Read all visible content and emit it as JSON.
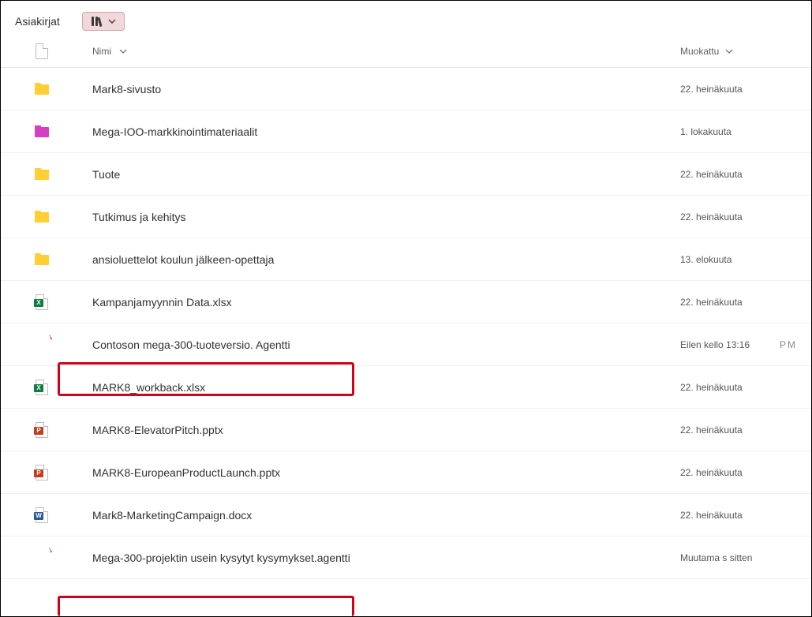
{
  "library_title": "Asiakirjat",
  "columns": {
    "name_label": "Nimi",
    "modified_label": "Muokattu"
  },
  "pm_suffix": "PM",
  "items": [
    {
      "icon": "folder",
      "name": "Mark8-sivusto",
      "modified": "22. heinäkuuta"
    },
    {
      "icon": "folder-pink",
      "name": "Mega-IOO-markkinointimateriaalit",
      "modified": "1. lokakuuta"
    },
    {
      "icon": "folder",
      "name": "Tuote",
      "modified": "22. heinäkuuta"
    },
    {
      "icon": "folder",
      "name": "Tutkimus ja kehitys",
      "modified": "22. heinäkuuta"
    },
    {
      "icon": "folder",
      "name": "ansioluettelot koulun jälkeen-opettaja",
      "modified": "13. elokuuta"
    },
    {
      "icon": "excel",
      "name": "Kampanjamyynnin Data.xlsx",
      "modified": "22. heinäkuuta"
    },
    {
      "icon": "copilot",
      "name": "Contoson mega-300-tuoteversio. Agentti",
      "modified": "Eilen kello 13:16",
      "pm": true
    },
    {
      "icon": "excel",
      "name": "MARK8_workback.xlsx",
      "modified": "22. heinäkuuta"
    },
    {
      "icon": "ppt",
      "name": "MARK8-ElevatorPitch.pptx",
      "modified": "22. heinäkuuta"
    },
    {
      "icon": "ppt",
      "name": "MARK8-EuropeanProductLaunch.pptx",
      "modified": "22. heinäkuuta"
    },
    {
      "icon": "word",
      "name": "Mark8-MarketingCampaign.docx",
      "modified": "22. heinäkuuta"
    },
    {
      "icon": "copilot",
      "name": "Mega-300-projektin usein kysytyt kysymykset.agentti",
      "modified": "Muutama s sitten"
    }
  ]
}
